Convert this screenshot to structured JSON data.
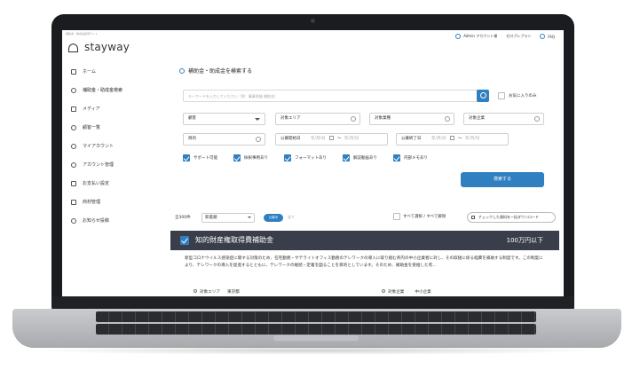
{
  "window": {
    "topline": "補助金・助成金検索サイト"
  },
  "brand": {
    "name": "stayway"
  },
  "topnav": {
    "admin_label": "Admin アカウント様",
    "plan_label": "ゼロプレプラン",
    "faq_label": "FAQ"
  },
  "sidebar": {
    "items": [
      {
        "label": "ホーム",
        "icon": "home-icon"
      },
      {
        "label": "補助金・助成金検索",
        "icon": "search-icon"
      },
      {
        "label": "メディア",
        "icon": "media-icon"
      },
      {
        "label": "顧客一覧",
        "icon": "users-icon"
      },
      {
        "label": "マイアカウント",
        "icon": "account-icon"
      },
      {
        "label": "アカウント管理",
        "icon": "account-manage-icon"
      },
      {
        "label": "お支払い設定",
        "icon": "payment-icon"
      },
      {
        "label": "商材管理",
        "icon": "product-icon"
      },
      {
        "label": "お知らせ投稿",
        "icon": "notice-icon"
      }
    ]
  },
  "search": {
    "title": "補助金・助成金を検索する",
    "keyword_placeholder": "キーワードを入力してください（例：事業承継 補助金）",
    "favorites_label": "お気に入りのみ",
    "fields": {
      "customer": "顧客",
      "target_area": "対象エリア",
      "target_industry": "対象業種",
      "target_company": "対象企業",
      "purpose": "目的",
      "start_date_label": "公募開始日",
      "end_date_label": "公募終了日",
      "date_placeholder": "年/月/日"
    },
    "checkboxes": [
      "サポート可能",
      "採択事例あり",
      "フォーマットあり",
      "解説動画あり",
      "内部メモあり"
    ],
    "submit_label": "検索する"
  },
  "results": {
    "count": "全300件",
    "sort_value": "新着順",
    "toggle_on": "公募中",
    "toggle_off": "全て",
    "select_all_label": "すべて選択 / すべて解除",
    "download_label": "チェックした資料を一括ダウンロード"
  },
  "result_card": {
    "title": "知的財産権取得費補助金",
    "amount": "100万円以下",
    "description": "新型コロナウイルス感染症に関する対策のため、在宅勤務・サテライトオフィス勤務のテレワークの導入に取り組む県内の中小企業者に対し、その取組に係る経費を補助する制度です。この制度により、テレワークの導入を促進するとともに、テレワークの継続・定着を図ることを目的としています。そのため、補助金を受給した有...",
    "area_label": "対象エリア",
    "area_value": "東京都",
    "company_label": "対象企業",
    "company_value": "中小企業"
  }
}
